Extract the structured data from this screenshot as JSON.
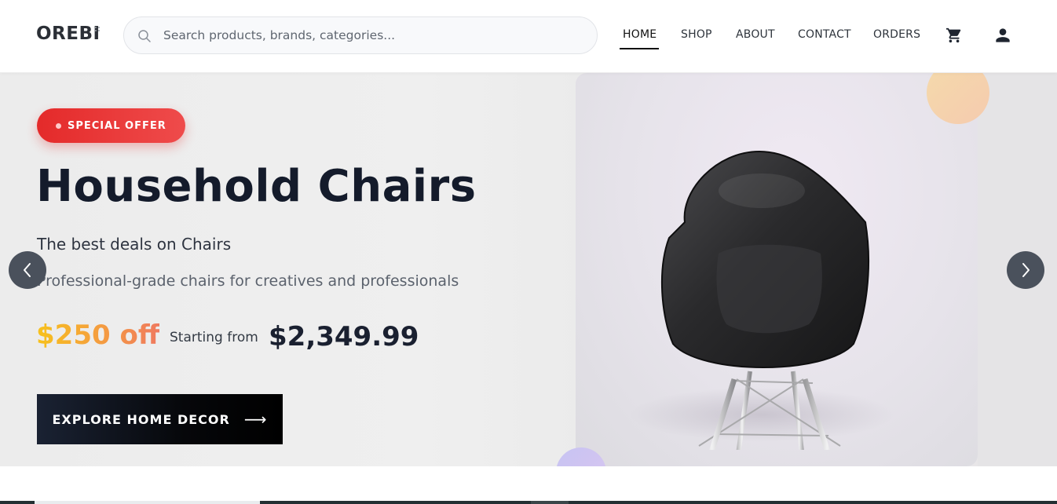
{
  "header": {
    "logo": "OREBI",
    "search": {
      "placeholder": "Search products, brands, categories..."
    },
    "nav": {
      "items": [
        {
          "label": "HOME",
          "active": true
        },
        {
          "label": "SHOP",
          "active": false
        },
        {
          "label": "ABOUT",
          "active": false
        },
        {
          "label": "CONTACT",
          "active": false
        },
        {
          "label": "ORDERS",
          "active": false
        }
      ]
    },
    "icons": {
      "search": "search-icon",
      "cart": "cart-icon",
      "account": "user-icon"
    }
  },
  "hero": {
    "badge": "SPECIAL OFFER",
    "title": "Household Chairs",
    "subtitle": "The best deals on Chairs",
    "description": "Professional-grade chairs for creatives and professionals",
    "discount": "$250 off",
    "starting_label": "Starting from",
    "price": "$2,349.99",
    "cta": "EXPLORE HOME DECOR",
    "cta_icon": "arrow-right-icon",
    "prev_icon": "chevron-left-icon",
    "next_icon": "chevron-right-icon"
  },
  "colors": {
    "badge": "#e42a2a",
    "title": "#141b2b",
    "discount_start": "#f7c21c",
    "discount_end": "#f07a5f",
    "cta_background": "#000000",
    "carousel_button": "#4a515c"
  }
}
